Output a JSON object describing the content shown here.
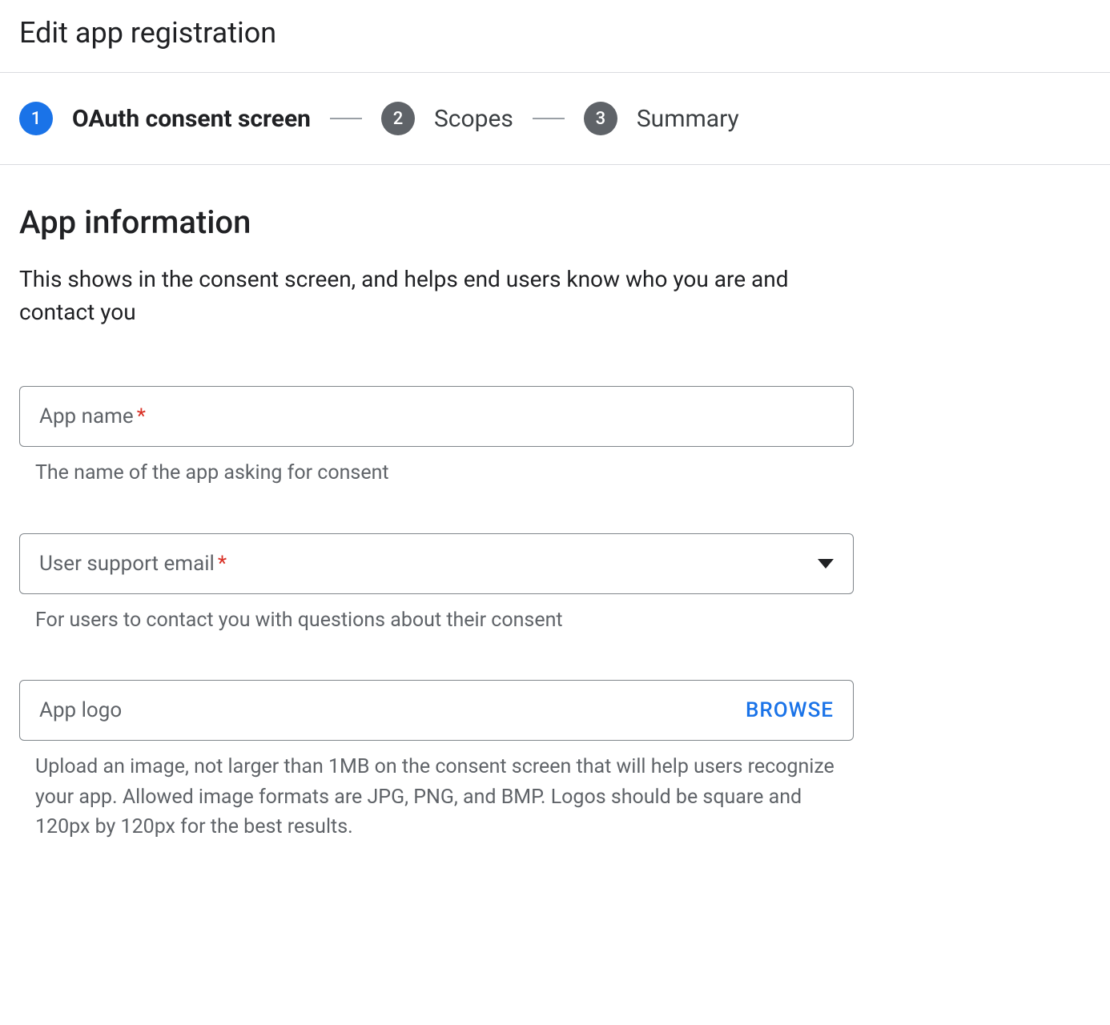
{
  "header": {
    "title": "Edit app registration"
  },
  "stepper": {
    "steps": [
      {
        "number": "1",
        "label": "OAuth consent screen",
        "active": true
      },
      {
        "number": "2",
        "label": "Scopes",
        "active": false
      },
      {
        "number": "3",
        "label": "Summary",
        "active": false
      }
    ]
  },
  "section": {
    "title": "App information",
    "description": "This shows in the consent screen, and helps end users know who you are and contact you"
  },
  "fields": {
    "appName": {
      "label": "App name",
      "required": "*",
      "helper": "The name of the app asking for consent"
    },
    "userSupportEmail": {
      "label": "User support email",
      "required": "*",
      "helper": "For users to contact you with questions about their consent"
    },
    "appLogo": {
      "label": "App logo",
      "browseLabel": "BROWSE",
      "helper": "Upload an image, not larger than 1MB on the consent screen that will help users recognize your app. Allowed image formats are JPG, PNG, and BMP. Logos should be square and 120px by 120px for the best results."
    }
  }
}
